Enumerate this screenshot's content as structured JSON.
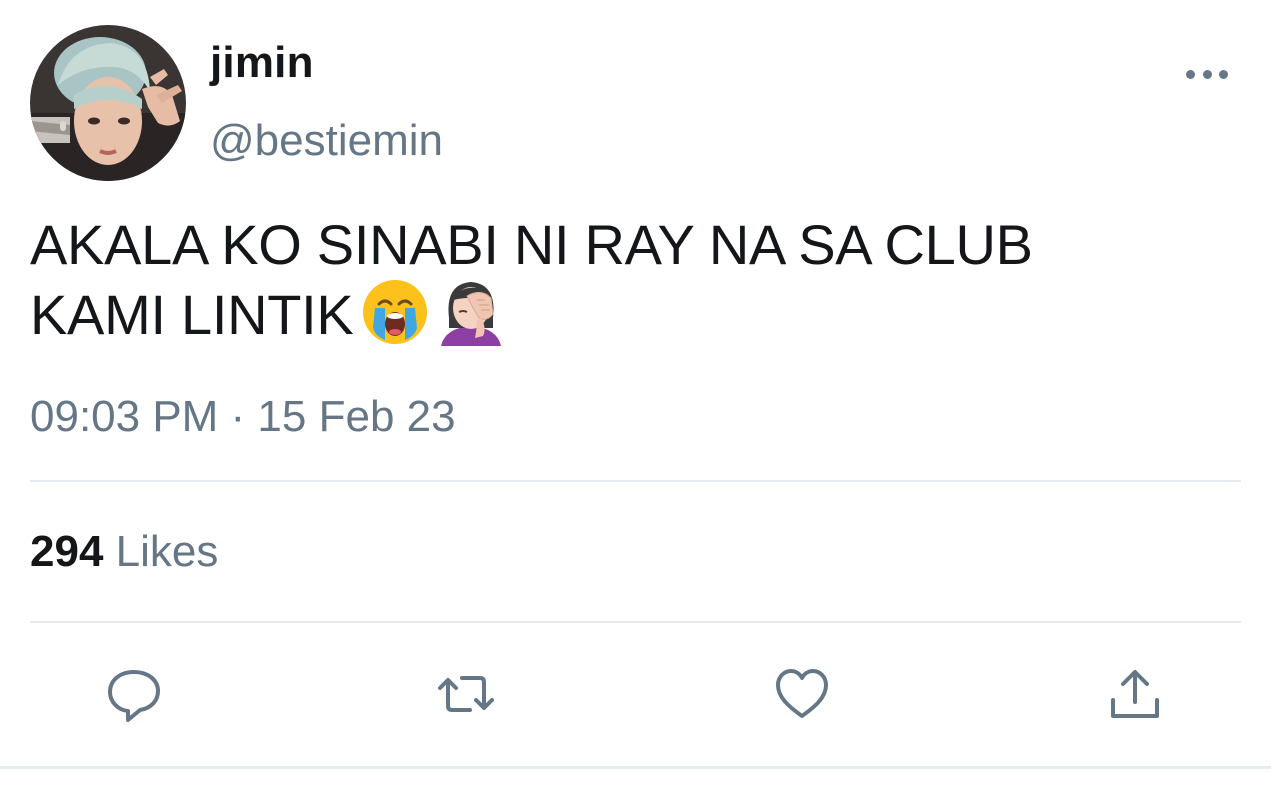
{
  "user": {
    "display_name": "jimin",
    "handle": "@bestiemin"
  },
  "tweet": {
    "text_line1": "AKALA KO SINABI NI RAY NA SA CLUB",
    "text_line2": "KAMI LINTIK",
    "emojis": [
      "loudly-crying-face",
      "woman-facepalming"
    ],
    "timestamp": "09:03 PM · 15 Feb 23"
  },
  "stats": {
    "likes_count": "294",
    "likes_label": "Likes"
  },
  "actions": [
    "reply-icon",
    "retweet-icon",
    "like-icon",
    "share-icon"
  ],
  "colors": {
    "text_primary": "#14171a",
    "text_secondary": "#657786",
    "divider": "#e6ecf0"
  }
}
